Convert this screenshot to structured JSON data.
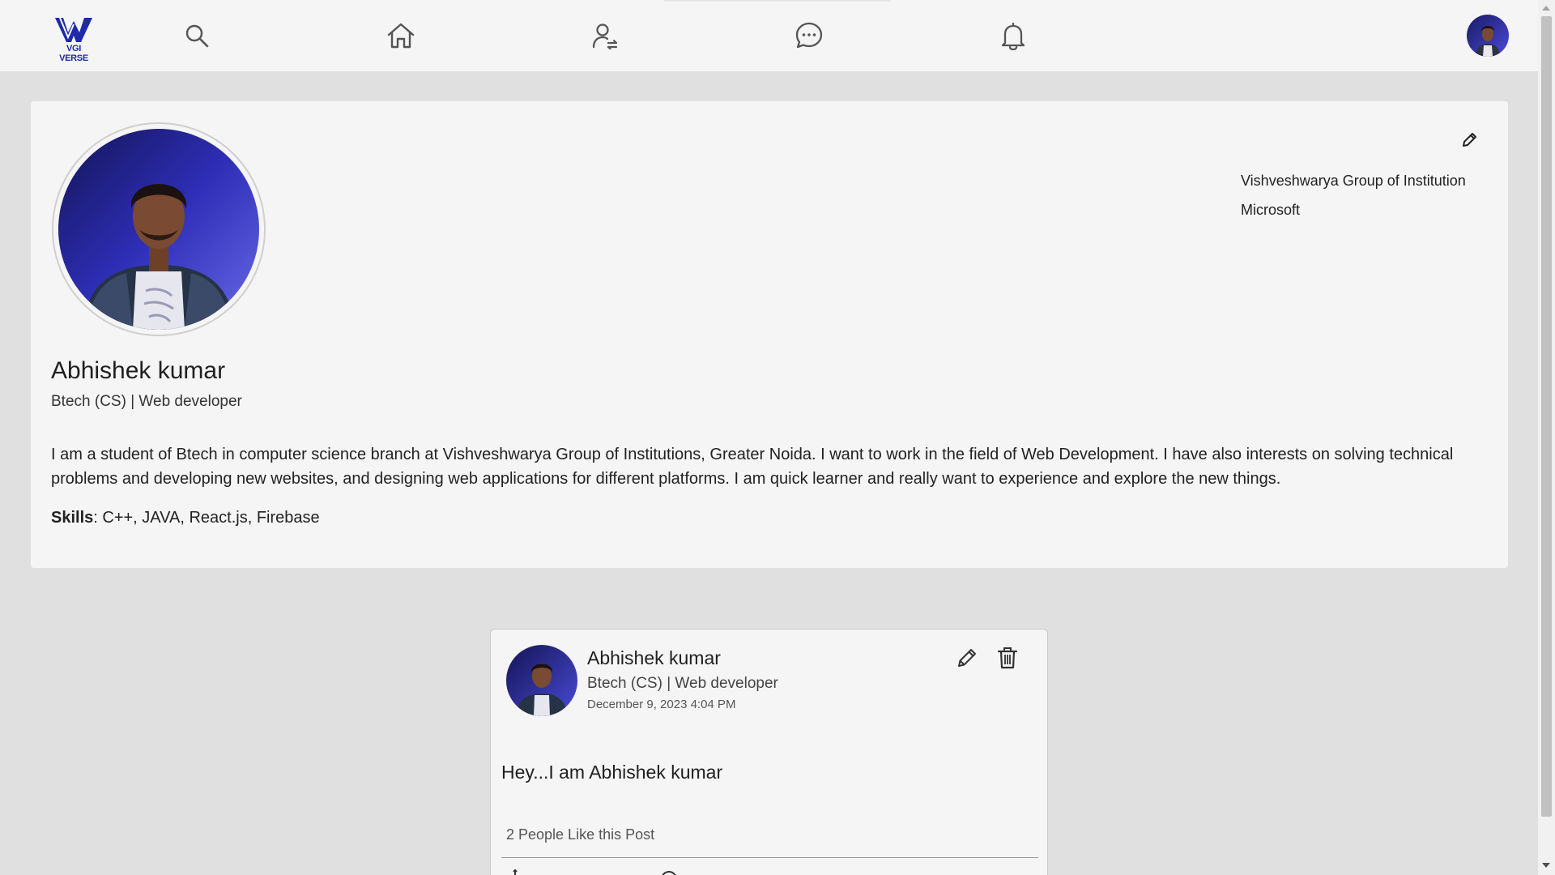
{
  "app": {
    "logo_text": "VGI VERSE",
    "brand_color": "#1e2aa8"
  },
  "nav": {
    "icons": [
      "search-icon",
      "home-icon",
      "connections-icon",
      "messages-icon",
      "notifications-icon"
    ]
  },
  "profile": {
    "name": "Abhishek kumar",
    "headline": "Btech (CS) | Web developer",
    "organizations": [
      "Vishveshwarya Group of Institution",
      "Microsoft"
    ],
    "about": "I am a student of Btech in computer science branch at Vishveshwarya Group of Institutions, Greater Noida. I want to work in the field of Web Development. I have also interests on solving technical problems and developing new websites, and designing web applications for different platforms. I am quick learner and really want to experience and explore the new things.",
    "skills_label": "Skills",
    "skills": ": C++, JAVA, React.js, Firebase"
  },
  "post": {
    "author": "Abhishek kumar",
    "headline": "Btech (CS) | Web developer",
    "timestamp": "December 9, 2023 4:04 PM",
    "text": "Hey...I am Abhishek kumar",
    "likes": "2 People Like this Post"
  }
}
